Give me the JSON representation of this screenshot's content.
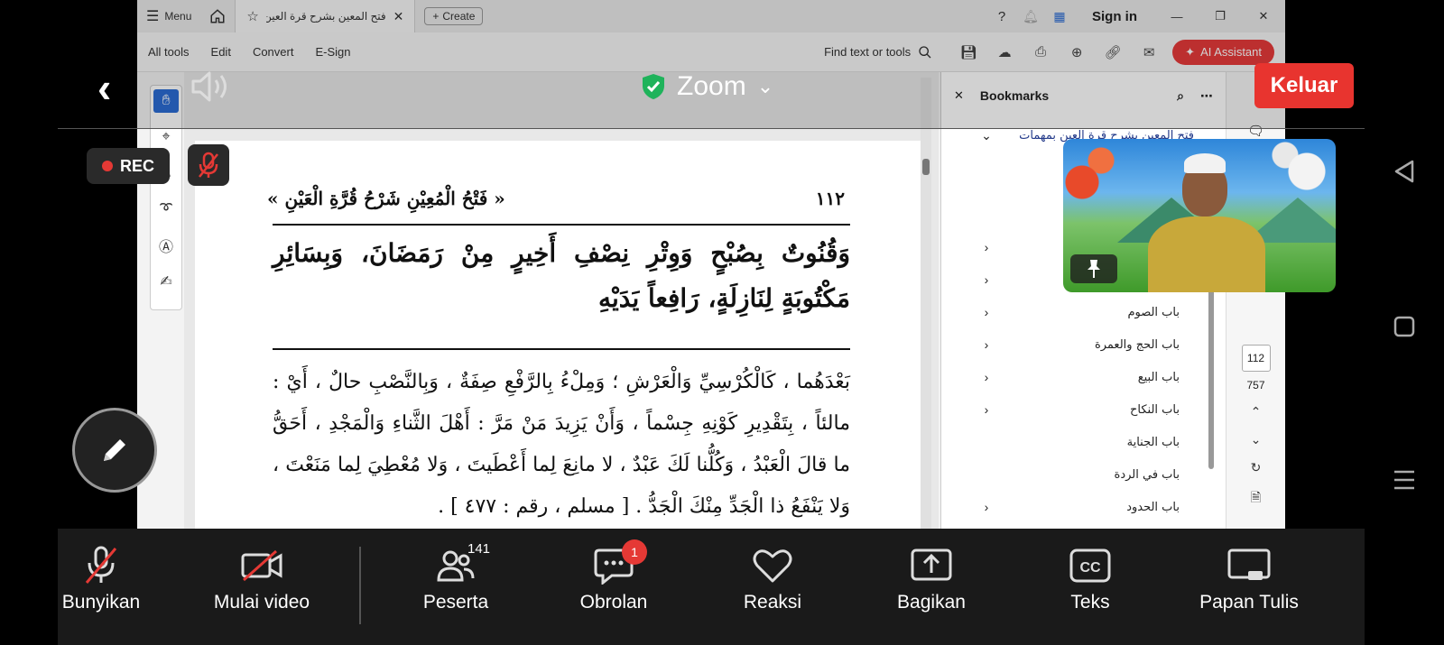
{
  "acrobat": {
    "menu_label": "Menu",
    "tab_title": "فتح المعين بشرح قرة العين ...",
    "create_label": "Create",
    "sign_in": "Sign in",
    "menus": [
      "All tools",
      "Edit",
      "Convert",
      "E-Sign"
    ],
    "find_placeholder": "Find text or tools",
    "ai_assistant": "AI Assistant"
  },
  "document": {
    "running_title": "« فَتْحُ الْمُعِيْنِ شَرْحُ قُرَّةِ الْعَيْنِ »",
    "page_number": "١١٢",
    "matn_text": "وَقُنُوتٌ بِصُبْحٍ وَوِتْرِ نِصْفِ أَخِيرٍ مِنْ رَمَضَانَ، وَبِسَائِرِ مَكْتُوبَةٍ لِنَازِلَةٍ، رَافِعاً يَدَيْهِ",
    "sharh_text": "بَعْدَهُما ، كَالْكُرْسِيِّ وَالْعَرْشِ ؛ وَمِلْءُ بِالرَّفْعِ صِفَةٌ ، وَبِالنَّصْبِ حالٌ ، أَيْ : مالئاً ، بِتَقْدِيرِ كَوْنِهِ جِسْماً ، وَأَنْ يَزِيدَ مَنْ مَرَّ : أَهْلَ الثَّناءِ وَالْمَجْدِ ، أَحَقُّ ما قالَ الْعَبْدُ ، وَكُلُّنا لَكَ عَبْدٌ ، لا مانِعَ لِما أَعْطَيتَ ، وَلا مُعْطِيَ لِما مَنَعْتَ ، وَلا يَنْفَعُ ذا الْجَدِّ مِنْكَ الْجَدُّ . [ مسلم ، رقم : ٤٧٧ ] ."
  },
  "bookmarks": {
    "title": "Bookmarks",
    "top_item": "فتح المعين بشرح قرة العين بمهمات",
    "items": [
      {
        "label": "باب الصوم"
      },
      {
        "label": "باب الحج والعمرة"
      },
      {
        "label": "باب البيع"
      },
      {
        "label": "باب النكاح"
      },
      {
        "label": "باب الجناية"
      },
      {
        "label": "باب في الردة"
      },
      {
        "label": "باب الحدود"
      }
    ]
  },
  "rail": {
    "current_page": "112",
    "total_pages": "757"
  },
  "zoom": {
    "title": "Zoom",
    "exit_label": "Keluar",
    "rec_label": "REC",
    "participants_count": "141",
    "chat_count": "1",
    "toolbar": {
      "unmute": "Bunyikan",
      "start_video": "Mulai video",
      "participants": "Peserta",
      "chat": "Obrolan",
      "reactions": "Reaksi",
      "share": "Bagikan",
      "captions": "Teks",
      "whiteboard": "Papan Tulis"
    }
  },
  "colors": {
    "exit_red": "#e8342f",
    "shield_green": "#1fb35b",
    "ai_red": "#e63a3a",
    "tool_blue": "#2b6cd4"
  }
}
